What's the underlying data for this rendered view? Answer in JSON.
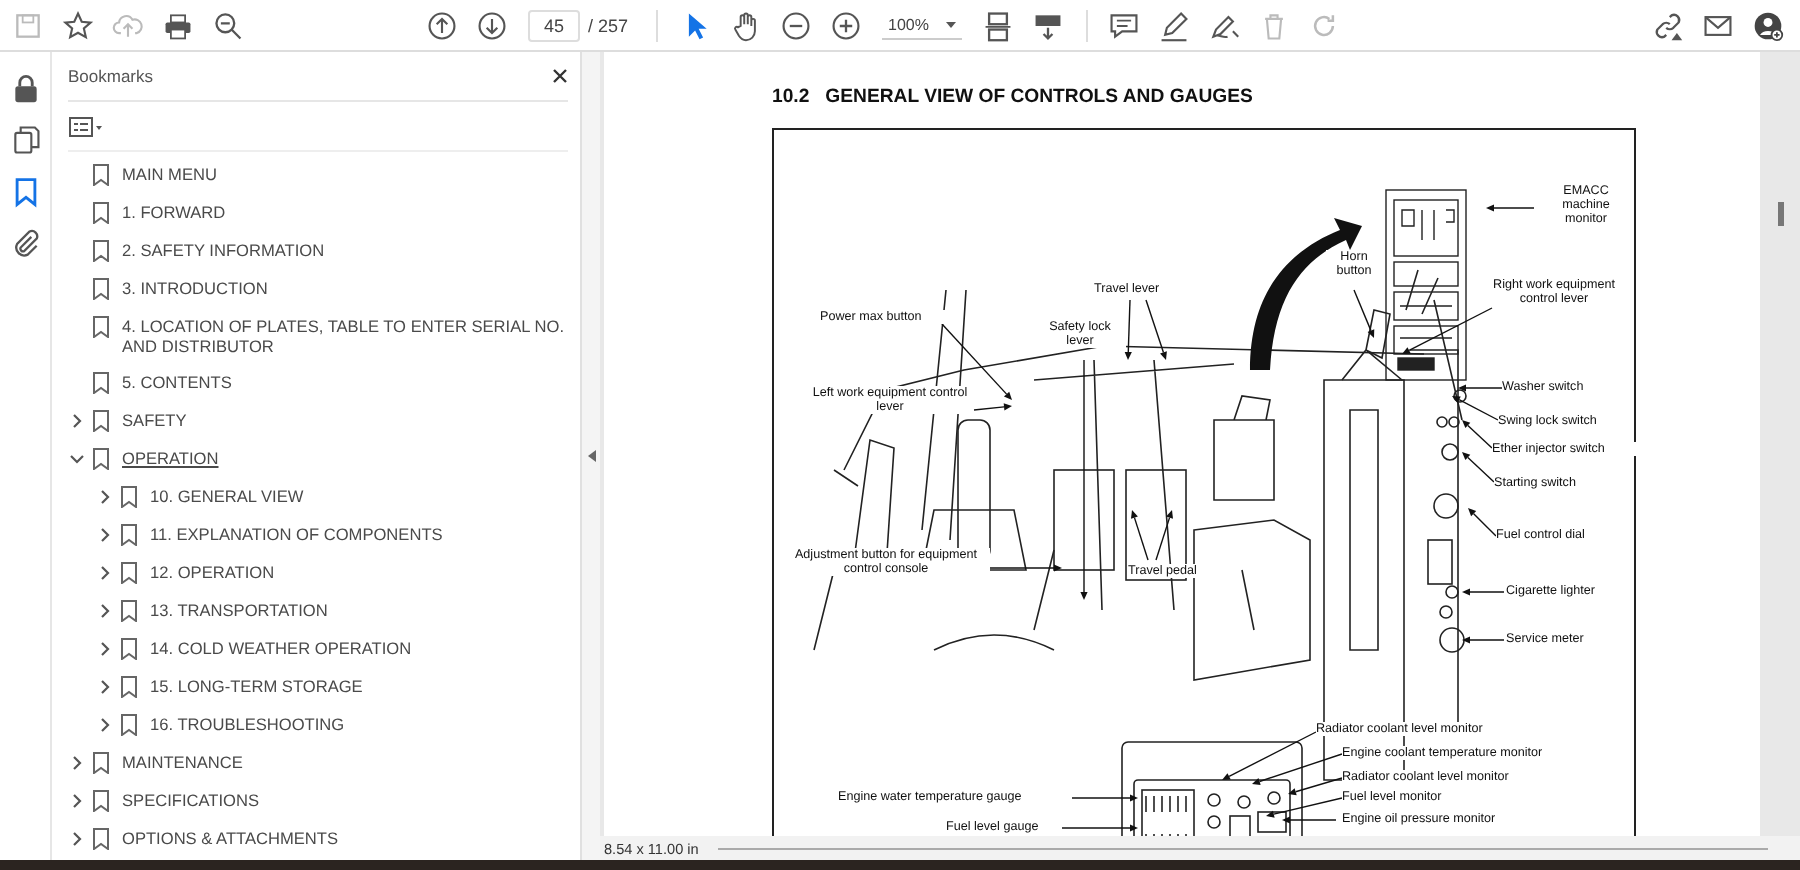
{
  "toolbar": {
    "page_number": "45",
    "page_count": "/ 257",
    "zoom": "100%"
  },
  "bookmarks": {
    "title": "Bookmarks",
    "items": [
      {
        "label": "MAIN MENU",
        "kind": "leaf",
        "selected": false
      },
      {
        "label": "1.  FORWARD",
        "kind": "leaf",
        "selected": false
      },
      {
        "label": "2.  SAFETY INFORMATION",
        "kind": "leaf",
        "selected": false
      },
      {
        "label": "3.  INTRODUCTION",
        "kind": "leaf",
        "selected": false
      },
      {
        "label": "4.  LOCATION OF PLATES, TABLE TO ENTER SERIAL NO. AND DISTRIBUTOR",
        "kind": "leaf",
        "selected": false
      },
      {
        "label": "5.  CONTENTS",
        "kind": "leaf",
        "selected": false
      },
      {
        "label": "SAFETY",
        "kind": "group",
        "expanded": false,
        "selected": false
      },
      {
        "label": "OPERATION",
        "kind": "group",
        "expanded": true,
        "selected": true,
        "children": [
          {
            "label": "10.  GENERAL VIEW",
            "kind": "group",
            "expanded": false,
            "selected": false
          },
          {
            "label": "11.  EXPLANATION OF COMPONENTS",
            "kind": "group",
            "expanded": false,
            "selected": false
          },
          {
            "label": "12.  OPERATION",
            "kind": "group",
            "expanded": false,
            "selected": false
          },
          {
            "label": "13.  TRANSPORTATION",
            "kind": "group",
            "expanded": false,
            "selected": false
          },
          {
            "label": "14.  COLD WEATHER OPERATION",
            "kind": "group",
            "expanded": false,
            "selected": false
          },
          {
            "label": "15.  LONG-TERM STORAGE",
            "kind": "group",
            "expanded": false,
            "selected": false
          },
          {
            "label": "16.  TROUBLESHOOTING",
            "kind": "group",
            "expanded": false,
            "selected": false
          }
        ]
      },
      {
        "label": "MAINTENANCE",
        "kind": "group",
        "expanded": false,
        "selected": false
      },
      {
        "label": "SPECIFICATIONS",
        "kind": "group",
        "expanded": false,
        "selected": false
      },
      {
        "label": "OPTIONS & ATTACHMENTS",
        "kind": "group",
        "expanded": false,
        "selected": false
      }
    ]
  },
  "document": {
    "heading": "10.2   GENERAL VIEW OF CONTROLS AND GAUGES",
    "labels": [
      "EMACC machine monitor",
      "Horn button",
      "Travel lever",
      "Right work equipment control lever",
      "Power max button",
      "Safety lock lever",
      "Washer switch",
      "Left work equipment control lever",
      "Swing lock switch",
      "Ether injector switch",
      "Starting switch",
      "Fuel control dial",
      "Adjustment button for equipment control console",
      "Travel pedal",
      "Cigarette lighter",
      "Service meter",
      "Radiator coolant level monitor",
      "Engine coolant temperature monitor",
      "Radiator coolant level monitor",
      "Engine water temperature gauge",
      "Fuel level monitor",
      "Engine oil pressure monitor",
      "Fuel level gauge"
    ]
  },
  "status_bar": {
    "page_size": "8.54 x 11.00 in"
  }
}
